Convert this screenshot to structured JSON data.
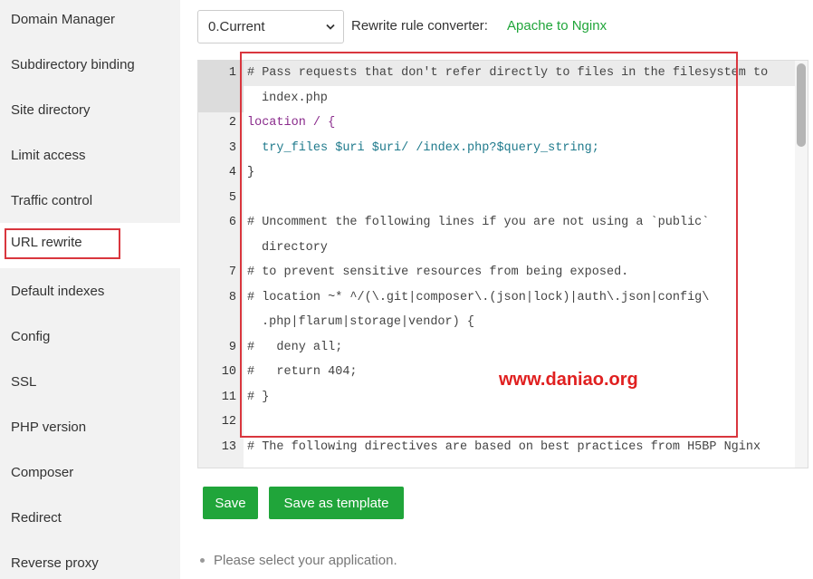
{
  "sidebar": {
    "items": [
      {
        "label": "Domain Manager"
      },
      {
        "label": "Subdirectory binding"
      },
      {
        "label": "Site directory"
      },
      {
        "label": "Limit access"
      },
      {
        "label": "Traffic control"
      },
      {
        "label": "URL rewrite",
        "active": true
      },
      {
        "label": "Default indexes"
      },
      {
        "label": "Config"
      },
      {
        "label": "SSL"
      },
      {
        "label": "PHP version"
      },
      {
        "label": "Composer"
      },
      {
        "label": "Redirect"
      },
      {
        "label": "Reverse proxy"
      }
    ]
  },
  "toolbar": {
    "selected_version": "0.Current",
    "converter_label": "Rewrite rule converter:",
    "converter_link": "Apache to Nginx"
  },
  "editor": {
    "lines": [
      {
        "n": "1",
        "text": "# Pass requests that don't refer directly to files in the filesystem to",
        "cont": "index.php"
      },
      {
        "n": "2",
        "text": "location / {"
      },
      {
        "n": "3",
        "text": "  try_files $uri $uri/ /index.php?$query_string;"
      },
      {
        "n": "4",
        "text": "}"
      },
      {
        "n": "5",
        "text": ""
      },
      {
        "n": "6",
        "text": "# Uncomment the following lines if you are not using a `public`",
        "cont": "directory"
      },
      {
        "n": "7",
        "text": "# to prevent sensitive resources from being exposed."
      },
      {
        "n": "8",
        "text": "# location ~* ^/(\\.git|composer\\.(json|lock)|auth\\.json|config\\",
        "cont": ".php|flarum|storage|vendor) {"
      },
      {
        "n": "9",
        "text": "#   deny all;"
      },
      {
        "n": "10",
        "text": "#   return 404;"
      },
      {
        "n": "11",
        "text": "# }"
      },
      {
        "n": "12",
        "text": ""
      },
      {
        "n": "13",
        "text": "# The following directives are based on best practices from H5BP Nginx"
      }
    ]
  },
  "watermark": "www.daniao.org",
  "buttons": {
    "save": "Save",
    "save_template": "Save as template"
  },
  "tip": "Please select your application.",
  "colors": {
    "accent": "#20a53a",
    "highlight": "#d9363e"
  }
}
